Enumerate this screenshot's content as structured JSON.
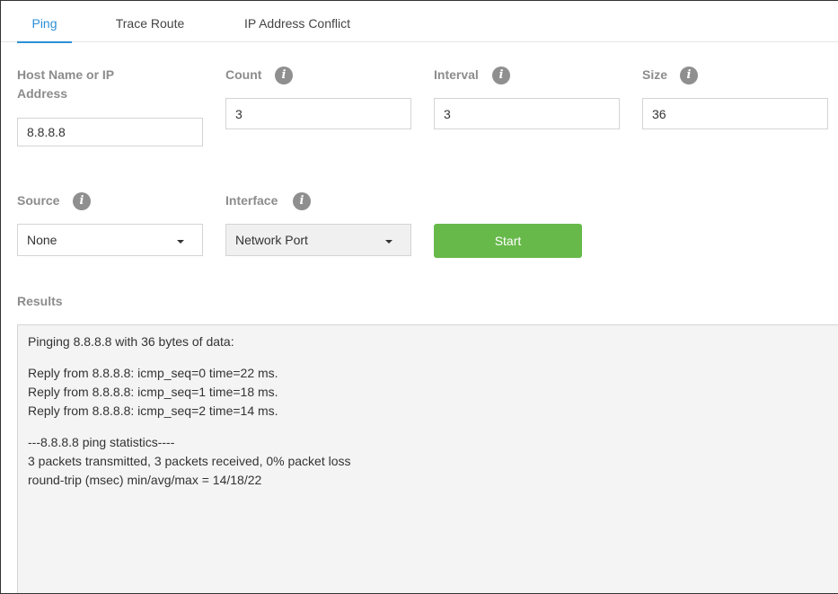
{
  "tabs": [
    {
      "label": "Ping",
      "active": true
    },
    {
      "label": "Trace Route",
      "active": false
    },
    {
      "label": "IP Address Conflict",
      "active": false
    }
  ],
  "form": {
    "host": {
      "label": "Host Name or IP Address",
      "value": "8.8.8.8"
    },
    "count": {
      "label": "Count",
      "value": "3",
      "info_icon": "info-icon"
    },
    "interval": {
      "label": "Interval",
      "value": "3",
      "info_icon": "info-icon"
    },
    "size": {
      "label": "Size",
      "value": "36",
      "info_icon": "info-icon"
    },
    "source": {
      "label": "Source",
      "selected": "None",
      "info_icon": "info-icon"
    },
    "interface": {
      "label": "Interface",
      "selected": "Network Port",
      "info_icon": "info-icon"
    },
    "start_label": "Start"
  },
  "results": {
    "label": "Results",
    "groups": [
      [
        "Pinging 8.8.8.8 with 36 bytes of data:"
      ],
      [
        "Reply from 8.8.8.8: icmp_seq=0 time=22 ms.",
        "Reply from 8.8.8.8: icmp_seq=1 time=18 ms.",
        "Reply from 8.8.8.8: icmp_seq=2 time=14 ms."
      ],
      [
        "---8.8.8.8 ping statistics----",
        "3 packets transmitted, 3 packets received, 0% packet loss",
        "round-trip (msec) min/avg/max = 14/18/22"
      ]
    ]
  },
  "colors": {
    "accent": "#2b8fd6",
    "start_button": "#67b94a",
    "label": "#8c8c8c",
    "results_bg": "#f4f4f4"
  }
}
